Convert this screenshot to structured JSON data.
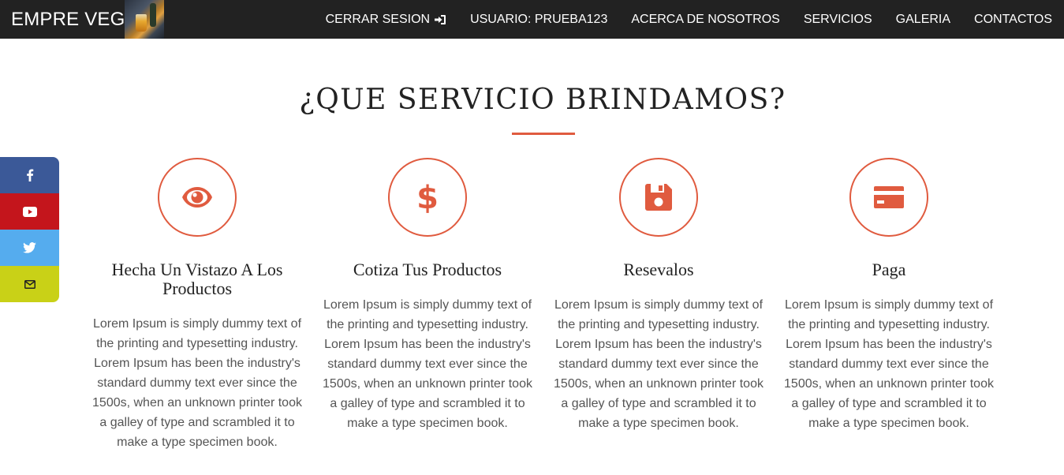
{
  "brand": {
    "name": "EMPRE VEG"
  },
  "nav": {
    "items": [
      {
        "label": "CERRAR SESION"
      },
      {
        "label": "USUARIO: PRUEBA123"
      },
      {
        "label": "ACERCA DE NOSOTROS"
      },
      {
        "label": "SERVICIOS"
      },
      {
        "label": "GALERIA"
      },
      {
        "label": "CONTACTOS"
      }
    ]
  },
  "social": {
    "items": [
      {
        "icon": "facebook-icon",
        "color": "#3b5998"
      },
      {
        "icon": "youtube-icon",
        "color": "#c4151c"
      },
      {
        "icon": "twitter-icon",
        "color": "#55acee"
      },
      {
        "icon": "envelope-icon",
        "color": "#c9d117"
      }
    ]
  },
  "section": {
    "title": "¿QUE SERVICIO BRINDAMOS?",
    "accent_color": "#e05b3f"
  },
  "services": [
    {
      "icon": "eye-icon",
      "title": "Hecha Un Vistazo A Los Productos",
      "text": "Lorem Ipsum is simply dummy text of the printing and typesetting industry. Lorem Ipsum has been the industry's standard dummy text ever since the 1500s, when an unknown printer took a galley of type and scrambled it to make a type specimen book."
    },
    {
      "icon": "dollar-icon",
      "title": "Cotiza Tus Productos",
      "text": "Lorem Ipsum is simply dummy text of the printing and typesetting industry. Lorem Ipsum has been the industry's standard dummy text ever since the 1500s, when an unknown printer took a galley of type and scrambled it to make a type specimen book."
    },
    {
      "icon": "floppy-disk-icon",
      "title": "Resevalos",
      "text": "Lorem Ipsum is simply dummy text of the printing and typesetting industry. Lorem Ipsum has been the industry's standard dummy text ever since the 1500s, when an unknown printer took a galley of type and scrambled it to make a type specimen book."
    },
    {
      "icon": "credit-card-icon",
      "title": "Paga",
      "text": "Lorem Ipsum is simply dummy text of the printing and typesetting industry. Lorem Ipsum has been the industry's standard dummy text ever since the 1500s, when an unknown printer took a galley of type and scrambled it to make a type specimen book."
    }
  ]
}
